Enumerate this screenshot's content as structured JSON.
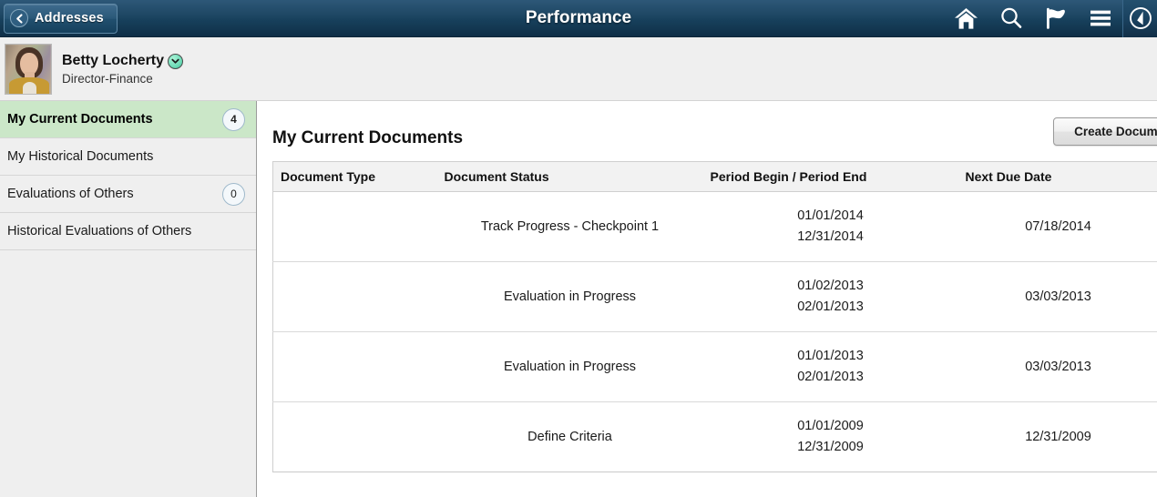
{
  "titlebar": {
    "back_label": "Addresses",
    "title": "Performance",
    "icons": [
      {
        "name": "home-icon",
        "label": "Home"
      },
      {
        "name": "search-icon",
        "label": "Search"
      },
      {
        "name": "flag-icon",
        "label": "Notifications"
      },
      {
        "name": "hamburger-menu-icon",
        "label": "Actions"
      },
      {
        "name": "compass-navigator-icon",
        "label": "NavBar"
      }
    ]
  },
  "profile": {
    "name": "Betty Locherty",
    "job_title": "Director-Finance",
    "badge_icon": "chevron-down-icon",
    "badge_color": "#6fdcb8"
  },
  "sidebar": {
    "items": [
      {
        "label": "My Current Documents",
        "badge": "4",
        "active": true
      },
      {
        "label": "My Historical Documents",
        "badge": "",
        "active": false
      },
      {
        "label": "Evaluations of Others",
        "badge": "0",
        "active": false
      },
      {
        "label": "Historical Evaluations of Others",
        "badge": "",
        "active": false
      }
    ]
  },
  "main": {
    "heading": "My Current Documents",
    "create_button": "Create Document",
    "table": {
      "columns": [
        "Document Type",
        "Document Status",
        "Period Begin / Period End",
        "Next Due Date"
      ],
      "rows": [
        {
          "document_type": "",
          "document_status": "Track Progress - Checkpoint 1",
          "period_begin": "01/01/2014",
          "period_end": "12/31/2014",
          "next_due_date": "07/18/2014"
        },
        {
          "document_type": "",
          "document_status": "Evaluation in Progress",
          "period_begin": "01/02/2013",
          "period_end": "02/01/2013",
          "next_due_date": "03/03/2013"
        },
        {
          "document_type": "",
          "document_status": "Evaluation in Progress",
          "period_begin": "01/01/2013",
          "period_end": "02/01/2013",
          "next_due_date": "03/03/2013"
        },
        {
          "document_type": "",
          "document_status": "Define Criteria",
          "period_begin": "01/01/2009",
          "period_end": "12/31/2009",
          "next_due_date": "12/31/2009"
        }
      ]
    }
  },
  "colors": {
    "titlebar_dark": "#17405c",
    "active_sidebar": "#cbe7c8",
    "sidebar_bg": "#efefef",
    "table_header_bg": "#f2f2f2"
  }
}
